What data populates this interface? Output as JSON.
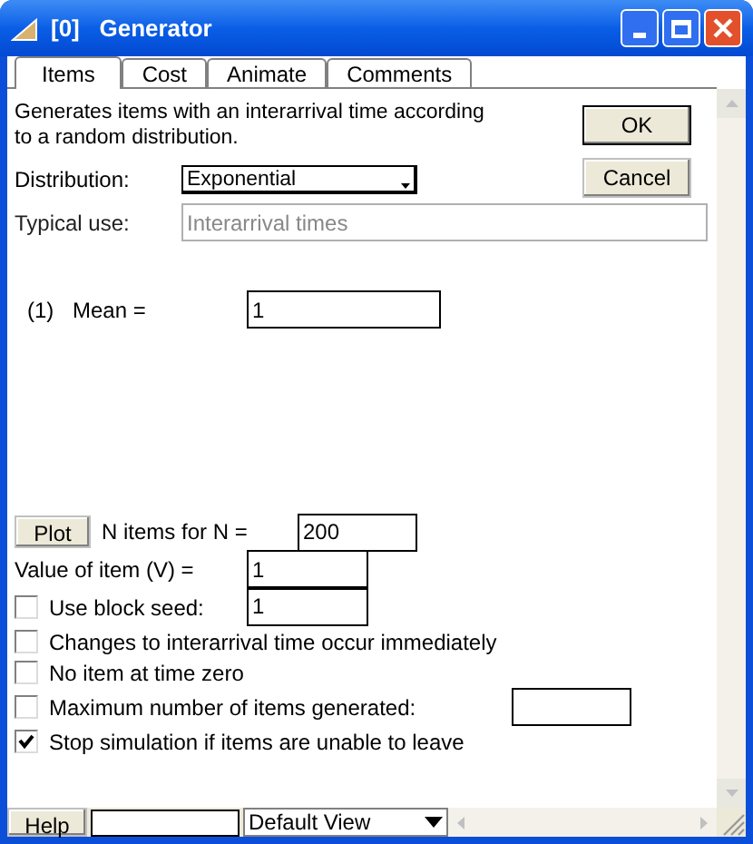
{
  "window": {
    "title": "[0]   Generator"
  },
  "tabs": [
    {
      "label": "Items",
      "selected": true
    },
    {
      "label": "Cost",
      "selected": false
    },
    {
      "label": "Animate",
      "selected": false
    },
    {
      "label": "Comments",
      "selected": false
    }
  ],
  "description": "Generates items with an interarrival time according to a random distribution.",
  "buttons": {
    "ok": "OK",
    "cancel": "Cancel"
  },
  "distribution": {
    "label": "Distribution:",
    "value": "Exponential"
  },
  "typical_use": {
    "label": "Typical use:",
    "value": "Interarrival times"
  },
  "parameters": [
    {
      "index": "(1)",
      "label": "Mean =",
      "value": "1"
    }
  ],
  "plot": {
    "button": "Plot",
    "label": "N items for N =",
    "value": "200"
  },
  "value_of_item": {
    "label": "Value of item (V) =",
    "value": "1"
  },
  "options": [
    {
      "kind": "seed",
      "label": "Use block seed:",
      "checked": false,
      "value": "1"
    },
    {
      "kind": "plain",
      "label": "Changes to interarrival time occur immediately",
      "checked": false
    },
    {
      "kind": "plain",
      "label": "No item at time zero",
      "checked": false
    },
    {
      "kind": "limit",
      "label": "Maximum number of items generated:",
      "checked": false
    },
    {
      "kind": "plain",
      "label": "Stop simulation if items are unable to leave",
      "checked": true
    }
  ],
  "bottom_bar": {
    "help": "Help",
    "view": "Default View"
  }
}
